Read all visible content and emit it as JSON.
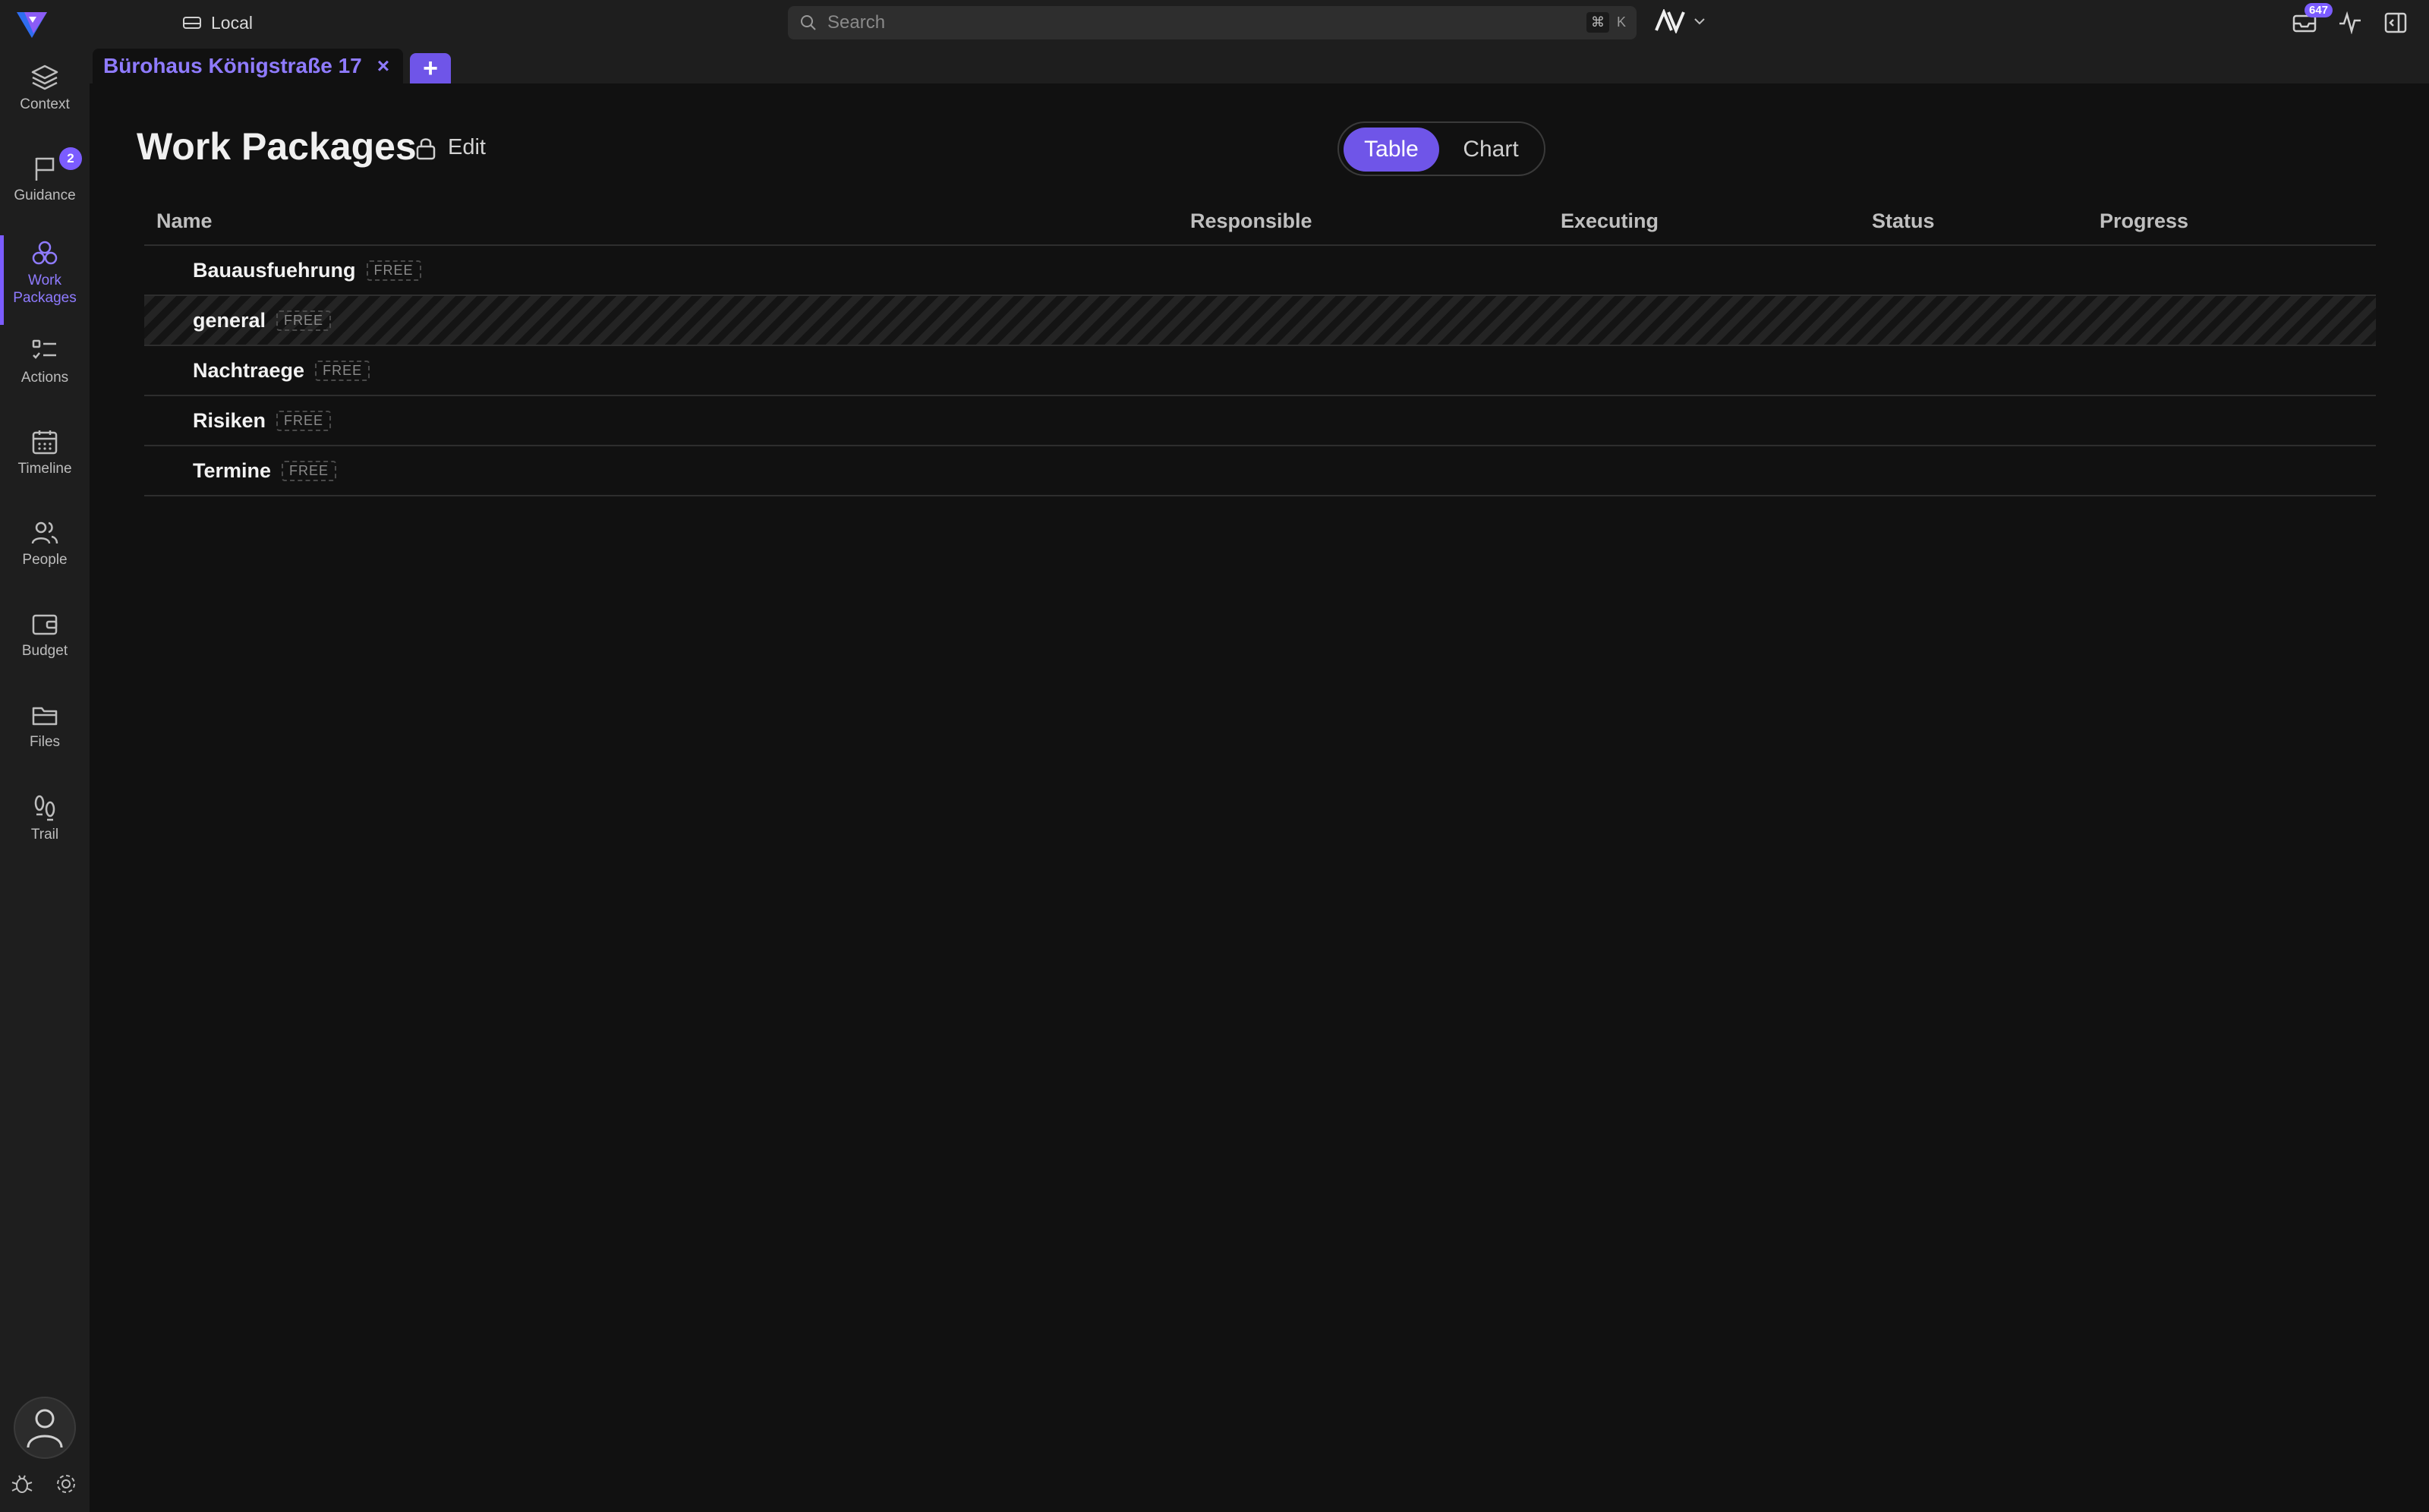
{
  "topbar": {
    "workspace": "Local",
    "search_placeholder": "Search",
    "shortcut_cmd": "⌘",
    "shortcut_key": "K",
    "inbox_count": "647"
  },
  "tabs": [
    {
      "title": "Bürohaus Königstraße 17",
      "close": "×"
    }
  ],
  "add_tab_label": "+",
  "sidebar": {
    "items": [
      {
        "label": "Context",
        "icon": "layers-icon"
      },
      {
        "label": "Guidance",
        "icon": "flag-icon",
        "badge": "2"
      },
      {
        "label": "Work\nPackages",
        "icon": "packages-icon",
        "active": true
      },
      {
        "label": "Actions",
        "icon": "list-check-icon"
      },
      {
        "label": "Timeline",
        "icon": "calendar-icon"
      },
      {
        "label": "People",
        "icon": "people-icon"
      },
      {
        "label": "Budget",
        "icon": "wallet-icon"
      },
      {
        "label": "Files",
        "icon": "folder-icon"
      },
      {
        "label": "Trail",
        "icon": "footprints-icon"
      }
    ]
  },
  "main": {
    "title": "Work Packages",
    "edit_label": "Edit",
    "view_toggle": {
      "table": "Table",
      "chart": "Chart",
      "selected": "Table"
    },
    "columns": [
      "Name",
      "Responsible",
      "Executing",
      "Status",
      "Progress"
    ],
    "rows": [
      {
        "name": "Bauausfuehrung",
        "tag": "FREE"
      },
      {
        "name": "general",
        "tag": "FREE",
        "highlighted": true
      },
      {
        "name": "Nachtraege",
        "tag": "FREE"
      },
      {
        "name": "Risiken",
        "tag": "FREE"
      },
      {
        "name": "Termine",
        "tag": "FREE"
      }
    ]
  },
  "colors": {
    "accent": "#7b5cff",
    "background": "#111111",
    "panel": "#1e1e1e"
  }
}
